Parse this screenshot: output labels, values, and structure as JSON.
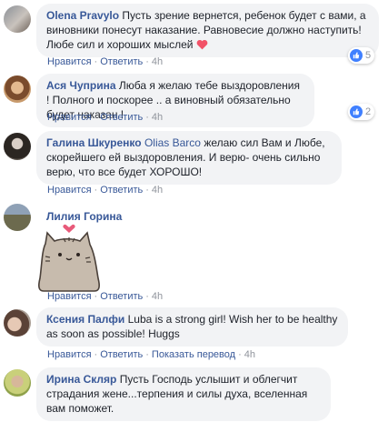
{
  "actions": {
    "like": "Нравится",
    "reply": "Ответить",
    "see_translation": "Показать перевод",
    "separator": "·"
  },
  "comments": [
    {
      "author": "Olena Pravylo",
      "text": "Пусть зрение вернется, ребенок будет с вами, а виновники понесут наказание. Равновесие должно наступить! Любе сил и хороших мыслей",
      "time": "4h",
      "reactions": "5",
      "heart_color": "#f25268"
    },
    {
      "author": "Ася Чуприна",
      "text": "Люба я желаю тебе выздоровления ! Полного и поскорее .. а виновный обязательно будет наказан !",
      "time": "4h",
      "reactions": "2"
    },
    {
      "author": "Галина Шкуренко",
      "tagged": "Olias Barco",
      "text": "желаю сил Вам и Любе, скорейшего ей выздоровления. И верю- очень сильно верю, что все будет ХОРОШО!",
      "time": "4h"
    },
    {
      "author": "Лилия Горина",
      "sticker": "pusheen-cat-heart-sticker",
      "time": "4h"
    },
    {
      "author": "Ксения Палфи",
      "text": "Luba is a strong girl! Wish her to be healthy as soon as possible! Huggs",
      "time": "4h"
    },
    {
      "author": "Ирина Скляр",
      "text": "Пусть Господь услышит и облегчит страдания жене...терпения и силы духа, вселенная вам поможет."
    }
  ],
  "colors": {
    "link": "#385898",
    "bubble": "#f2f3f5",
    "muted": "#90949c",
    "like_blue": "#4080ff"
  },
  "icons": {
    "reaction": "thumbs-up-icon"
  }
}
